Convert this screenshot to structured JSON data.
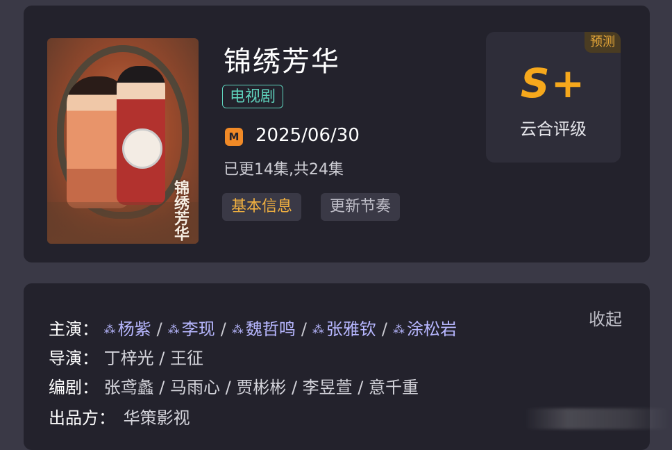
{
  "show": {
    "title": "锦绣芳华",
    "type_tag": "电视剧",
    "poster_title": "锦绣芳华",
    "release_date": "2025/06/30",
    "platform_icon": "mango-tv-icon",
    "episodes": "已更14集,共24集"
  },
  "tabs": {
    "basic_info": "基本信息",
    "update_rhythm": "更新节奏"
  },
  "rating": {
    "badge": "预测",
    "grade": "S+",
    "label": "云合评级"
  },
  "details": {
    "collapse_label": "收起",
    "cast_label": "主演：",
    "cast": [
      "杨紫",
      "李现",
      "魏哲鸣",
      "张雅钦",
      "涂松岩"
    ],
    "director_label": "导演：",
    "director": "丁梓光 / 王征",
    "writer_label": "编剧：",
    "writer": "张鸢蠡 / 马雨心 / 贾彬彬 / 李昱萱 / 意千重",
    "producer_label": "出品方：",
    "producer": "华策影视"
  },
  "colors": {
    "page_bg": "#3a3946",
    "card_bg": "#23222c",
    "accent_teal": "#5fd3bd",
    "accent_orange": "#f6a81c",
    "cast_link": "#b7b7ff"
  }
}
